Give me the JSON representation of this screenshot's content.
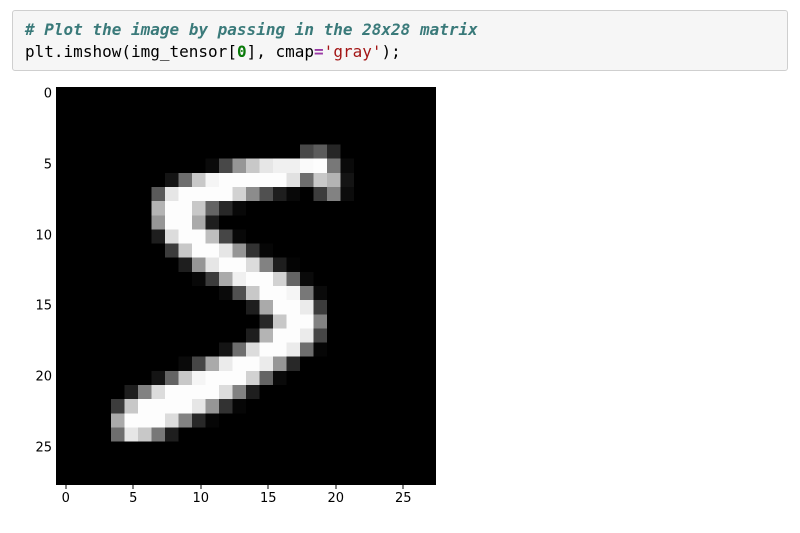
{
  "code": {
    "comment": "# Plot the image by passing in the 28x28 matrix",
    "line2_parts": {
      "plt": "plt",
      "dot1": ".",
      "imshow": "imshow",
      "lparen": "(",
      "img_tensor": "img_tensor",
      "lbrack": "[",
      "zero": "0",
      "rbrack": "]",
      "comma": ", ",
      "cmap": "cmap",
      "equals": "=",
      "strq1": "'",
      "gray": "gray",
      "strq2": "'",
      "rparen": ")",
      "semi": ";"
    }
  },
  "chart_data": {
    "type": "heatmap",
    "title": "",
    "xlabel": "",
    "ylabel": "",
    "xlim": [
      -0.5,
      27.5
    ],
    "ylim": [
      27.5,
      -0.5
    ],
    "x_ticks": [
      0,
      5,
      10,
      15,
      20,
      25
    ],
    "y_ticks": [
      0,
      5,
      10,
      15,
      20,
      25
    ],
    "cmap": "gray",
    "rows": 28,
    "cols": 28,
    "data": [
      [
        0,
        0,
        0,
        0,
        0,
        0,
        0,
        0,
        0,
        0,
        0,
        0,
        0,
        0,
        0,
        0,
        0,
        0,
        0,
        0,
        0,
        0,
        0,
        0,
        0,
        0,
        0,
        0
      ],
      [
        0,
        0,
        0,
        0,
        0,
        0,
        0,
        0,
        0,
        0,
        0,
        0,
        0,
        0,
        0,
        0,
        0,
        0,
        0,
        0,
        0,
        0,
        0,
        0,
        0,
        0,
        0,
        0
      ],
      [
        0,
        0,
        0,
        0,
        0,
        0,
        0,
        0,
        0,
        0,
        0,
        0,
        0,
        0,
        0,
        0,
        0,
        0,
        0,
        0,
        0,
        0,
        0,
        0,
        0,
        0,
        0,
        0
      ],
      [
        0,
        0,
        0,
        0,
        0,
        0,
        0,
        0,
        0,
        0,
        0,
        0,
        0,
        0,
        0,
        0,
        0,
        0,
        0,
        0,
        0,
        0,
        0,
        0,
        0,
        0,
        0,
        0
      ],
      [
        0,
        0,
        0,
        0,
        0,
        0,
        0,
        0,
        0,
        0,
        0,
        0,
        0,
        0,
        0,
        0,
        0,
        0,
        72,
        92,
        38,
        0,
        0,
        0,
        0,
        0,
        0,
        0
      ],
      [
        0,
        0,
        0,
        0,
        0,
        0,
        0,
        0,
        0,
        0,
        0,
        10,
        72,
        150,
        200,
        230,
        240,
        240,
        250,
        253,
        120,
        10,
        0,
        0,
        0,
        0,
        0,
        0
      ],
      [
        0,
        0,
        0,
        0,
        0,
        0,
        0,
        0,
        20,
        110,
        200,
        245,
        253,
        253,
        253,
        253,
        253,
        225,
        110,
        200,
        180,
        20,
        0,
        0,
        0,
        0,
        0,
        0
      ],
      [
        0,
        0,
        0,
        0,
        0,
        0,
        0,
        90,
        230,
        253,
        253,
        253,
        253,
        210,
        140,
        80,
        30,
        8,
        0,
        60,
        130,
        12,
        0,
        0,
        0,
        0,
        0,
        0
      ],
      [
        0,
        0,
        0,
        0,
        0,
        0,
        0,
        180,
        253,
        253,
        200,
        100,
        40,
        8,
        0,
        0,
        0,
        0,
        0,
        0,
        0,
        0,
        0,
        0,
        0,
        0,
        0,
        0
      ],
      [
        0,
        0,
        0,
        0,
        0,
        0,
        0,
        150,
        253,
        253,
        170,
        30,
        0,
        0,
        0,
        0,
        0,
        0,
        0,
        0,
        0,
        0,
        0,
        0,
        0,
        0,
        0,
        0
      ],
      [
        0,
        0,
        0,
        0,
        0,
        0,
        0,
        30,
        220,
        253,
        253,
        190,
        70,
        8,
        0,
        0,
        0,
        0,
        0,
        0,
        0,
        0,
        0,
        0,
        0,
        0,
        0,
        0
      ],
      [
        0,
        0,
        0,
        0,
        0,
        0,
        0,
        0,
        60,
        200,
        253,
        253,
        230,
        150,
        50,
        6,
        0,
        0,
        0,
        0,
        0,
        0,
        0,
        0,
        0,
        0,
        0,
        0
      ],
      [
        0,
        0,
        0,
        0,
        0,
        0,
        0,
        0,
        0,
        30,
        150,
        230,
        253,
        253,
        220,
        130,
        30,
        4,
        0,
        0,
        0,
        0,
        0,
        0,
        0,
        0,
        0,
        0
      ],
      [
        0,
        0,
        0,
        0,
        0,
        0,
        0,
        0,
        0,
        0,
        8,
        60,
        170,
        240,
        253,
        253,
        210,
        100,
        10,
        0,
        0,
        0,
        0,
        0,
        0,
        0,
        0,
        0
      ],
      [
        0,
        0,
        0,
        0,
        0,
        0,
        0,
        0,
        0,
        0,
        0,
        0,
        10,
        80,
        200,
        253,
        253,
        245,
        120,
        10,
        0,
        0,
        0,
        0,
        0,
        0,
        0,
        0
      ],
      [
        0,
        0,
        0,
        0,
        0,
        0,
        0,
        0,
        0,
        0,
        0,
        0,
        0,
        0,
        30,
        170,
        253,
        253,
        235,
        60,
        0,
        0,
        0,
        0,
        0,
        0,
        0,
        0
      ],
      [
        0,
        0,
        0,
        0,
        0,
        0,
        0,
        0,
        0,
        0,
        0,
        0,
        0,
        0,
        0,
        40,
        200,
        253,
        253,
        130,
        0,
        0,
        0,
        0,
        0,
        0,
        0,
        0
      ],
      [
        0,
        0,
        0,
        0,
        0,
        0,
        0,
        0,
        0,
        0,
        0,
        0,
        0,
        0,
        30,
        180,
        253,
        253,
        235,
        70,
        0,
        0,
        0,
        0,
        0,
        0,
        0,
        0
      ],
      [
        0,
        0,
        0,
        0,
        0,
        0,
        0,
        0,
        0,
        0,
        0,
        0,
        20,
        110,
        220,
        253,
        253,
        235,
        110,
        6,
        0,
        0,
        0,
        0,
        0,
        0,
        0,
        0
      ],
      [
        0,
        0,
        0,
        0,
        0,
        0,
        0,
        0,
        0,
        10,
        70,
        170,
        235,
        253,
        253,
        235,
        150,
        40,
        0,
        0,
        0,
        0,
        0,
        0,
        0,
        0,
        0,
        0
      ],
      [
        0,
        0,
        0,
        0,
        0,
        0,
        0,
        20,
        100,
        200,
        245,
        253,
        253,
        253,
        210,
        100,
        10,
        0,
        0,
        0,
        0,
        0,
        0,
        0,
        0,
        0,
        0,
        0
      ],
      [
        0,
        0,
        0,
        0,
        0,
        30,
        130,
        220,
        253,
        253,
        253,
        253,
        220,
        130,
        30,
        0,
        0,
        0,
        0,
        0,
        0,
        0,
        0,
        0,
        0,
        0,
        0,
        0
      ],
      [
        0,
        0,
        0,
        0,
        60,
        200,
        253,
        253,
        253,
        253,
        230,
        150,
        50,
        6,
        0,
        0,
        0,
        0,
        0,
        0,
        0,
        0,
        0,
        0,
        0,
        0,
        0,
        0
      ],
      [
        0,
        0,
        0,
        0,
        170,
        253,
        253,
        253,
        220,
        130,
        40,
        6,
        0,
        0,
        0,
        0,
        0,
        0,
        0,
        0,
        0,
        0,
        0,
        0,
        0,
        0,
        0,
        0
      ],
      [
        0,
        0,
        0,
        0,
        110,
        230,
        200,
        120,
        30,
        0,
        0,
        0,
        0,
        0,
        0,
        0,
        0,
        0,
        0,
        0,
        0,
        0,
        0,
        0,
        0,
        0,
        0,
        0
      ],
      [
        0,
        0,
        0,
        0,
        0,
        0,
        0,
        0,
        0,
        0,
        0,
        0,
        0,
        0,
        0,
        0,
        0,
        0,
        0,
        0,
        0,
        0,
        0,
        0,
        0,
        0,
        0,
        0
      ],
      [
        0,
        0,
        0,
        0,
        0,
        0,
        0,
        0,
        0,
        0,
        0,
        0,
        0,
        0,
        0,
        0,
        0,
        0,
        0,
        0,
        0,
        0,
        0,
        0,
        0,
        0,
        0,
        0
      ],
      [
        0,
        0,
        0,
        0,
        0,
        0,
        0,
        0,
        0,
        0,
        0,
        0,
        0,
        0,
        0,
        0,
        0,
        0,
        0,
        0,
        0,
        0,
        0,
        0,
        0,
        0,
        0,
        0
      ]
    ]
  }
}
